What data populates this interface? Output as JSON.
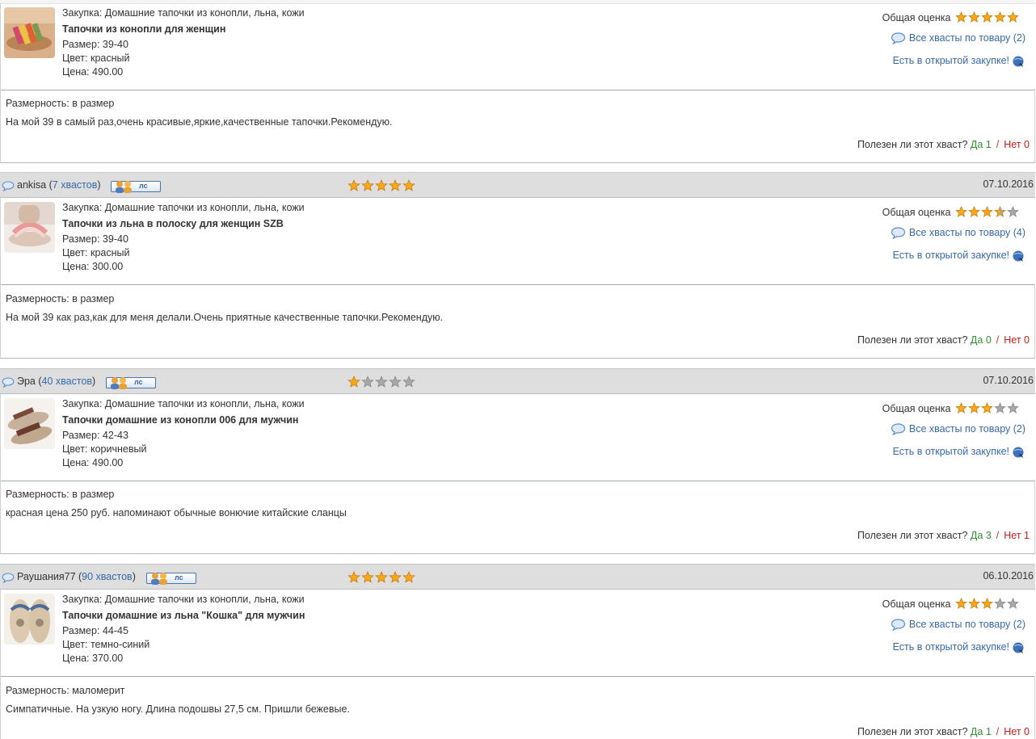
{
  "labels": {
    "purchase_prefix": "Закупка: ",
    "size_prefix": "Размер: ",
    "color_prefix": "Цвет: ",
    "price_prefix": "Цена: ",
    "overall_rating": "Общая оценка",
    "open_purchase": "Есть в открытой закупке!",
    "sizing_prefix": "Размерность: ",
    "useful_question": "Полезен ли этот хваст?",
    "yes": "Да",
    "no": "Нет",
    "slash": "/",
    "ls_button": "лс"
  },
  "reviews": [
    {
      "user": "",
      "count_label": "",
      "stars": 0,
      "date": "",
      "purchase": "Домашние тапочки из конопли, льна, кожи",
      "title": "Тапочки из конопли для женщин",
      "size": "39-40",
      "color": "красный",
      "price": "490.00",
      "overall_stars": 5,
      "all_reviews": "Все хвасты по товару (2)",
      "sizing": "в размер",
      "text": "На мой 39 в самый раз,очень красивые,яркие,качественные тапочки.Рекомендую.",
      "yes_count": "1",
      "no_count": "0"
    },
    {
      "user": "ankisa",
      "count_label": "7 хвастов",
      "stars": 5,
      "date": "07.10.2016",
      "purchase": "Домашние тапочки из конопли, льна, кожи",
      "title": "Тапочки из льна в полоску для женщин SZB",
      "size": "39-40",
      "color": "красный",
      "price": "300.00",
      "overall_stars": 3.5,
      "all_reviews": "Все хвасты по товару (4)",
      "sizing": "в размер",
      "text": "На мой 39 как раз,как для меня делали.Очень приятные качественные тапочки.Рекомендую.",
      "yes_count": "0",
      "no_count": "0"
    },
    {
      "user": "Эра",
      "count_label": "40 хвастов",
      "stars": 1,
      "date": "07.10.2016",
      "purchase": "Домашние тапочки из конопли, льна, кожи",
      "title": "Тапочки домашние из конопли 006 для мужчин",
      "size": "42-43",
      "color": "коричневый",
      "price": "490.00",
      "overall_stars": 3,
      "all_reviews": "Все хвасты по товару (2)",
      "sizing": "в размер",
      "text": "красная цена 250 руб. напоминают обычные вонючие китайские сланцы",
      "yes_count": "3",
      "no_count": "1"
    },
    {
      "user": "Раушания77",
      "count_label": "90 хвастов",
      "stars": 5,
      "date": "06.10.2016",
      "purchase": "Домашние тапочки из конопли, льна, кожи",
      "title": "Тапочки домашние из льна \"Кошка\" для мужчин",
      "size": "44-45",
      "color": "темно-синий",
      "price": "370.00",
      "overall_stars": 3,
      "all_reviews": "Все хвасты по товару (2)",
      "sizing": "маломерит",
      "text": "Симпатичные. На узкую ногу. Длина подошвы 27,5 см. Пришли бежевые.",
      "yes_count": "1",
      "no_count": "0"
    }
  ],
  "colors": {
    "link": "#3569a8",
    "yes": "#2f8f2f",
    "no": "#d01818",
    "star_full": "#f7a81b",
    "star_empty": "#a7a7a7",
    "header_bg": "#dedede"
  }
}
